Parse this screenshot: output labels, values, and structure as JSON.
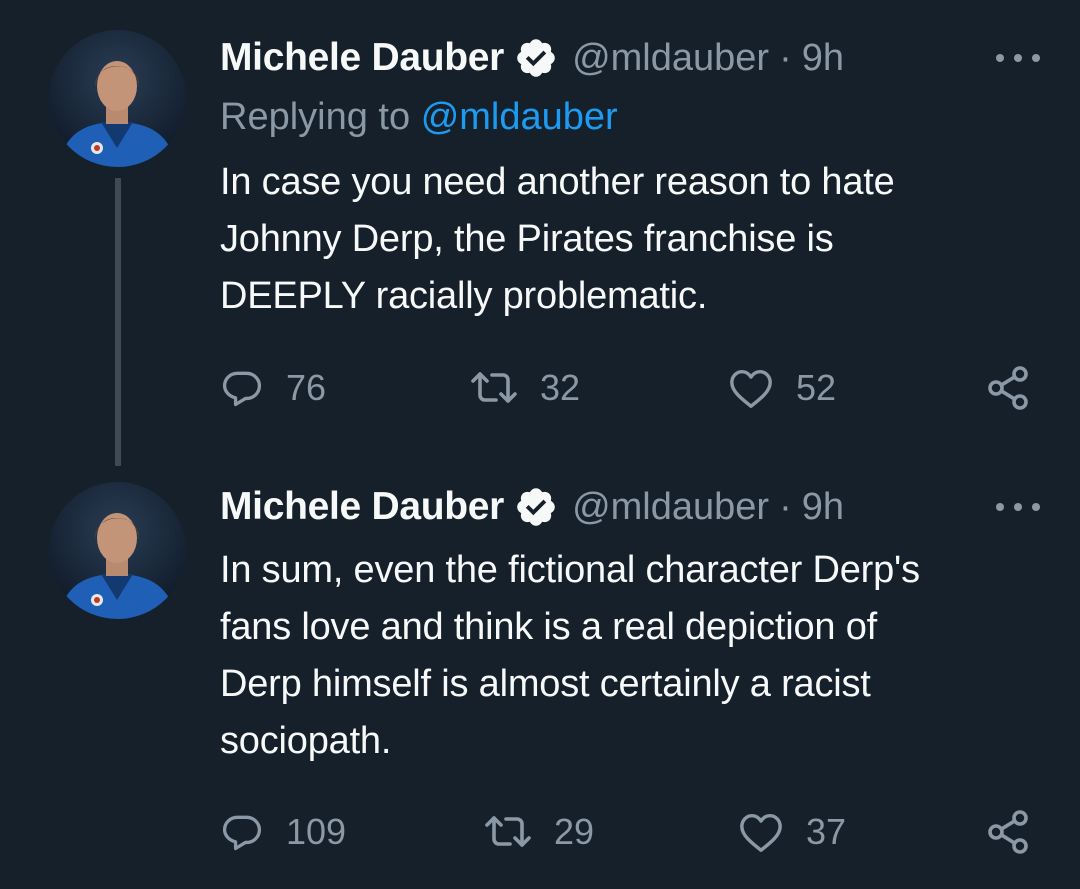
{
  "theme": {
    "background": "#15202b",
    "text_primary": "#f7f9f9",
    "text_secondary": "#8b98a5",
    "accent": "#1d9bf0",
    "thread_line": "#3e4a56"
  },
  "tweets": [
    {
      "author_name": "Michele Dauber",
      "handle": "@mldauber",
      "separator": "·",
      "time": "9h",
      "replying_prefix": "Replying to",
      "replying_to": "@mldauber",
      "lines": [
        "In case you need another reason to hate",
        "Johnny Derp, the Pirates franchise is",
        "DEEPLY racially problematic."
      ],
      "replies": "76",
      "retweets": "32",
      "likes": "52",
      "icons": {
        "verified": "verified-badge-icon",
        "more": "more-options-icon",
        "reply": "reply-icon",
        "retweet": "retweet-icon",
        "like": "heart-icon",
        "share": "share-icon"
      }
    },
    {
      "author_name": "Michele Dauber",
      "handle": "@mldauber",
      "separator": "·",
      "time": "9h",
      "lines": [
        "In sum, even the fictional character Derp's",
        "fans love and think is a real depiction of",
        "Derp himself is almost certainly a racist",
        "sociopath."
      ],
      "replies": "109",
      "retweets": "29",
      "likes": "37",
      "icons": {
        "verified": "verified-badge-icon",
        "more": "more-options-icon",
        "reply": "reply-icon",
        "retweet": "retweet-icon",
        "like": "heart-icon",
        "share": "share-icon"
      }
    }
  ]
}
